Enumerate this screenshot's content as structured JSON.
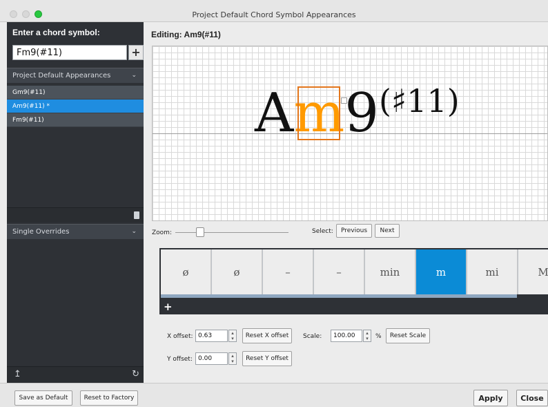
{
  "window": {
    "title": "Project Default Chord Symbol Appearances"
  },
  "sidebar": {
    "header": "Enter a chord symbol:",
    "chord_input_value": "Fm9(#11)",
    "add_label": "+",
    "project_section": "Project Default Appearances",
    "items": [
      {
        "label": "Gm9(#11)",
        "selected": false
      },
      {
        "label": "Am9(#11) *",
        "selected": true
      },
      {
        "label": "Fm9(#11)",
        "selected": false
      }
    ],
    "overrides_section": "Single Overrides"
  },
  "editor": {
    "editing_label": "Editing:",
    "editing_value": "Am9(#11)",
    "chord": {
      "root": "A",
      "quality": "m",
      "extension": "9",
      "alteration": "(♯11)"
    },
    "zoom_label": "Zoom:",
    "zoom_level": 0.2,
    "select_label": "Select:",
    "previous_label": "Previous",
    "next_label": "Next"
  },
  "palette": {
    "tiles": [
      {
        "label": "ø",
        "selected": false
      },
      {
        "label": "ø",
        "selected": false
      },
      {
        "label": "–",
        "selected": false
      },
      {
        "label": "–",
        "selected": false
      },
      {
        "label": "min",
        "selected": false
      },
      {
        "label": "m",
        "selected": true
      },
      {
        "label": "mi",
        "selected": false
      },
      {
        "label": "M",
        "selected": false
      }
    ],
    "add_label": "+"
  },
  "offsets": {
    "x_label": "X offset:",
    "x_value": "0.63",
    "reset_x": "Reset X offset",
    "scale_label": "Scale:",
    "scale_value": "100.00",
    "percent": "%",
    "reset_scale": "Reset Scale",
    "y_label": "Y offset:",
    "y_value": "0.00",
    "reset_y": "Reset Y offset"
  },
  "footer": {
    "save_default": "Save as Default",
    "reset_factory": "Reset to Factory",
    "apply": "Apply",
    "close": "Close"
  },
  "colors": {
    "selection": "#1f8de0",
    "highlight": "#ff9a00",
    "sidebar": "#2e3136"
  }
}
